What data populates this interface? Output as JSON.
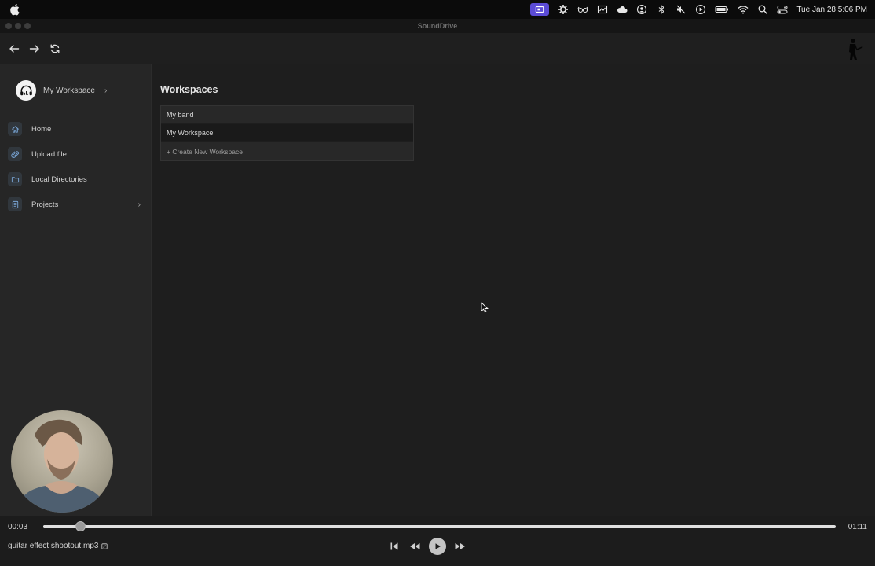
{
  "menubar": {
    "clock": "Tue Jan 28  5:06 PM",
    "icons": [
      "apple-icon",
      "screen-record-icon",
      "gear-icon",
      "glasses-icon",
      "display-icon",
      "cloud-icon",
      "user-circle-icon",
      "bluetooth-icon",
      "mute-icon",
      "play-circle-icon",
      "battery-icon",
      "wifi-icon",
      "spotlight-search-icon",
      "control-center-icon"
    ],
    "accent": "#5b4bd6"
  },
  "window": {
    "title": "SoundDrive"
  },
  "sidebar": {
    "workspace_name": "My Workspace",
    "items": [
      {
        "label": "Home",
        "icon": "home-icon"
      },
      {
        "label": "Upload file",
        "icon": "paperclip-icon"
      },
      {
        "label": "Local Directories",
        "icon": "folder-icon"
      },
      {
        "label": "Projects",
        "icon": "document-icon"
      }
    ]
  },
  "main": {
    "title": "Workspaces",
    "workspaces": [
      {
        "name": "My band"
      },
      {
        "name": "My Workspace"
      }
    ],
    "create_label": "+ Create New Workspace"
  },
  "player": {
    "current_time": "00:03",
    "total_time": "01:11",
    "progress": 0.047,
    "track_name": "guitar effect shootout.mp3"
  }
}
